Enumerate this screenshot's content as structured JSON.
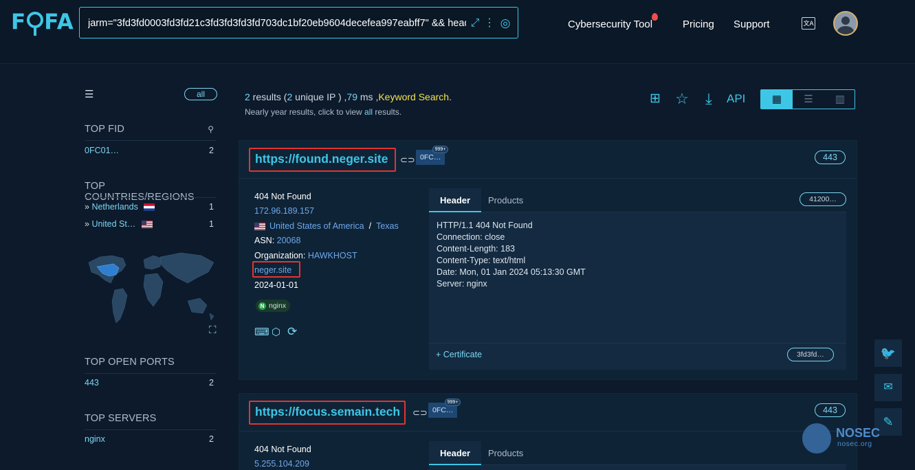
{
  "header": {
    "logo": "FOFA",
    "logo_parts": {
      "a": "F",
      "b": "FA"
    },
    "search_value": "jarm=\"3fd3fd0003fd3fd21c3fd3fd3fd3fd703dc1bf20eb9604decefea997eabff7\" && head",
    "nav": {
      "tool": "Cybersecurity Tool",
      "pricing": "Pricing",
      "support": "Support"
    },
    "translate_glyph": "文A"
  },
  "sidebar": {
    "all_label": "all",
    "top_fid": {
      "title": "TOP FID",
      "items": [
        {
          "label": "0FC01…",
          "count": "2"
        }
      ]
    },
    "top_countries": {
      "title": "TOP COUNTRIES/REGIONS",
      "items": [
        {
          "label": "Netherlands",
          "count": "1"
        },
        {
          "label": "United St…",
          "count": "1"
        }
      ]
    },
    "top_ports": {
      "title": "TOP OPEN PORTS",
      "items": [
        {
          "label": "443",
          "count": "2"
        }
      ]
    },
    "top_servers": {
      "title": "TOP SERVERS",
      "items": [
        {
          "label": "nginx",
          "count": "2"
        }
      ]
    }
  },
  "summary": {
    "count": "2",
    "results_text": " results (",
    "unique": "2",
    "unique_text": " unique IP ) ,",
    "ms": "79",
    "ms_text": " ms ,",
    "keyword": "Keyword Search",
    "dot": ".",
    "sub_prefix": "Nearly year results, click to view ",
    "sub_all": "all",
    "sub_suffix": " results."
  },
  "toolbar": {
    "api": "API"
  },
  "results": [
    {
      "host": "https://found.neger.site",
      "fid": "0FC…",
      "fid_badge": "999+",
      "port": "443",
      "title": "404 Not Found",
      "ip": "172.96.189.157",
      "country": "United States of America",
      "sep": "/",
      "region": "Texas",
      "asn_label": "ASN: ",
      "asn": "20068",
      "org_label": "Organization: ",
      "org": "HAWKHOST",
      "domain": "neger.site",
      "date": "2024-01-01",
      "tech": "nginx",
      "tabs": {
        "header": "Header",
        "products": "Products"
      },
      "jarm_pill": "41200…",
      "header_lines": [
        "HTTP/1.1 404 Not Found",
        "Connection: close",
        "Content-Length: 183",
        "Content-Type: text/html",
        "Date: Mon, 01 Jan 2024 05:13:30 GMT",
        "Server: nginx"
      ],
      "cert_label": "+ Certificate",
      "cert_pill": "3fd3fd…"
    },
    {
      "host": "https://focus.semain.tech",
      "fid": "0FC…",
      "fid_badge": "999+",
      "port": "443",
      "title": "404 Not Found",
      "ip": "5.255.104.209",
      "tabs": {
        "header": "Header",
        "products": "Products"
      }
    }
  ],
  "watermark": {
    "name": "NOSEC",
    "domain": "nosec.org"
  }
}
